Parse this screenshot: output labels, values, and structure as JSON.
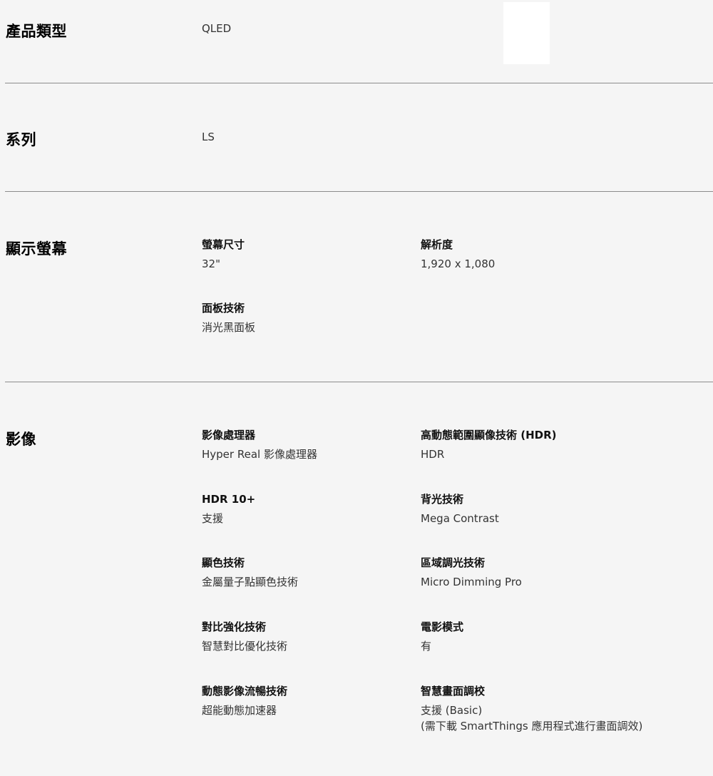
{
  "product_type": {
    "title": "產品類型",
    "value": "QLED"
  },
  "series": {
    "title": "系列",
    "value": "LS"
  },
  "display": {
    "title": "顯示螢幕",
    "specs": [
      {
        "label": "螢幕尺寸",
        "value": "32\""
      },
      {
        "label": "解析度",
        "value": "1,920 x 1,080"
      },
      {
        "label": "面板技術",
        "value": "消光黑面板"
      }
    ]
  },
  "image": {
    "title": "影像",
    "specs": [
      {
        "label": "影像處理器",
        "value": "Hyper Real 影像處理器"
      },
      {
        "label": "高動態範圍顯像技術 (HDR)",
        "value": "HDR"
      },
      {
        "label": "HDR 10+",
        "value": "支援"
      },
      {
        "label": "背光技術",
        "value": "Mega Contrast"
      },
      {
        "label": "顯色技術",
        "value": "金屬量子點顯色技術"
      },
      {
        "label": "區域調光技術",
        "value": "Micro Dimming Pro"
      },
      {
        "label": "對比強化技術",
        "value": "智慧對比優化技術"
      },
      {
        "label": "電影模式",
        "value": "有"
      },
      {
        "label": "動態影像流暢技術",
        "value": "超能動態加速器"
      },
      {
        "label": "智慧畫面調校",
        "value": "支援 (Basic)\n(需下載 SmartThings 應用程式進行畫面調效)"
      }
    ]
  }
}
